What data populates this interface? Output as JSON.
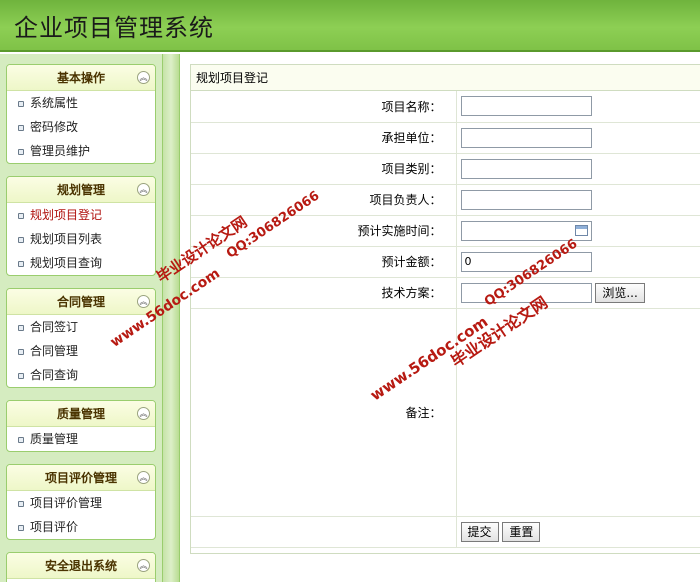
{
  "app": {
    "title": "企业项目管理系统"
  },
  "sidebar": {
    "groups": [
      {
        "title": "基本操作",
        "items": [
          "系统属性",
          "密码修改",
          "管理员维护"
        ]
      },
      {
        "title": "规划管理",
        "items": [
          "规划项目登记",
          "规划项目列表",
          "规划项目查询"
        ]
      },
      {
        "title": "合同管理",
        "items": [
          "合同签订",
          "合同管理",
          "合同查询"
        ]
      },
      {
        "title": "质量管理",
        "items": [
          "质量管理"
        ]
      },
      {
        "title": "项目评价管理",
        "items": [
          "项目评价管理",
          "项目评价"
        ]
      },
      {
        "title": "安全退出系统",
        "items": []
      }
    ],
    "active_item": "规划项目登记"
  },
  "form": {
    "title": "规划项目登记",
    "fields": [
      {
        "label": "项目名称：",
        "value": ""
      },
      {
        "label": "承担单位：",
        "value": ""
      },
      {
        "label": "项目类别：",
        "value": ""
      },
      {
        "label": "项目负责人：",
        "value": ""
      },
      {
        "label": "预计实施时间：",
        "value": ""
      },
      {
        "label": "预计金额：",
        "value": "0"
      },
      {
        "label": "技术方案：",
        "value": ""
      },
      {
        "label": "备注：",
        "value": ""
      }
    ],
    "browse_label": "浏览...",
    "submit_label": "提交",
    "reset_label": "重置"
  },
  "watermarks": {
    "site": "www.56doc.com",
    "qq": "QQ:306826066",
    "name": "毕业设计论文网"
  }
}
